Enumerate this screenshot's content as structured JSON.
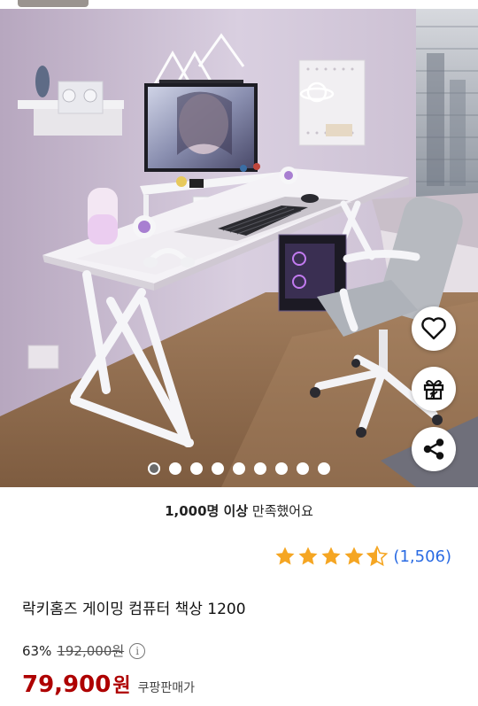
{
  "product": {
    "satisfied_bold": "1,000명 이상",
    "satisfied_rest": " 만족했어요",
    "rating_stars": 4.5,
    "review_count": "(1,506)",
    "title": "락키홈즈 게이밍 컴퓨터 책상 1200",
    "discount": "63%",
    "original_price": "192,000원",
    "info_icon_label": "i",
    "price": "79,900",
    "price_unit": "원",
    "seller": "쿠팡판매가"
  },
  "gallery": {
    "image_count": 9,
    "active_index": 0
  },
  "actions": {
    "wishlist_icon": "heart-icon",
    "gift_icon": "gift-icon",
    "share_icon": "share-icon"
  },
  "colors": {
    "price": "#ae0000",
    "star": "#f5a623",
    "review_link": "#2a6be3"
  }
}
